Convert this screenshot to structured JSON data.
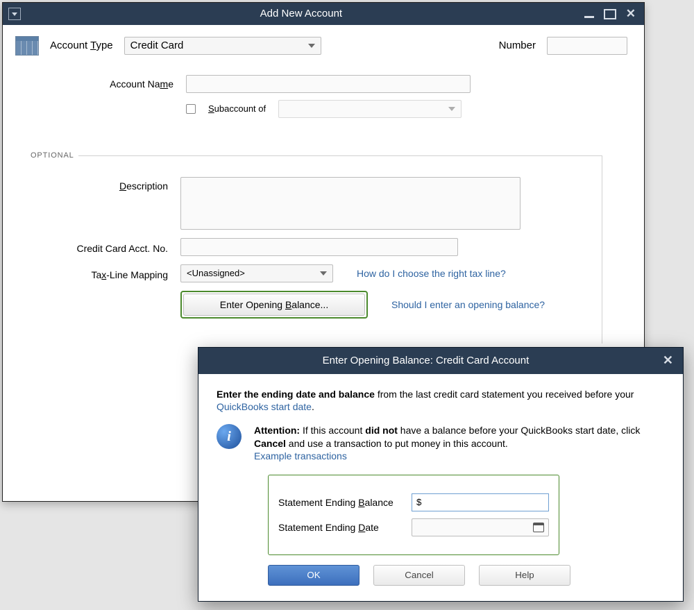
{
  "window": {
    "title": "Add New Account",
    "accountTypeLabel": "Account Type",
    "accountTypeValue": "Credit Card",
    "numberLabel": "Number",
    "numberValue": "",
    "accountNameLabel": "Account Name",
    "accountNameValue": "",
    "subaccountLabel": "Subaccount of",
    "subaccountValue": "",
    "optionalLabel": "OPTIONAL",
    "descriptionLabel": "Description",
    "descriptionValue": "",
    "ccAcctNoLabel": "Credit Card Acct. No.",
    "ccAcctNoValue": "",
    "taxLineLabel": "Tax-Line Mapping",
    "taxLineValue": "<Unassigned>",
    "taxHelpLink": "How do I choose the right tax line?",
    "openingBalanceButton": "Enter Opening Balance...",
    "openingHelpLink": "Should I enter an opening balance?"
  },
  "dialog": {
    "title": "Enter Opening Balance: Credit Card Account",
    "introBold": "Enter the ending date and balance",
    "introRest": " from the last credit card statement you received before your ",
    "introLink": "QuickBooks start date",
    "introEnd": ".",
    "attnLabel": "Attention:",
    "attnPart1": " If this account ",
    "attnBold1": "did not",
    "attnPart2": " have a balance before your QuickBooks start date, click ",
    "attnBold2": "Cancel",
    "attnPart3": " and use a transaction to put money in this account.",
    "exampleLink": "Example transactions",
    "balanceLabel": "Statement Ending Balance",
    "balanceValue": "$",
    "dateLabel": "Statement Ending Date",
    "dateValue": "",
    "ok": "OK",
    "cancel": "Cancel",
    "help": "Help"
  }
}
